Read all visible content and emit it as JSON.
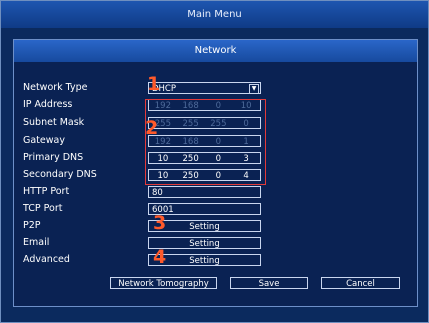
{
  "window": {
    "title": "Main Menu"
  },
  "dialog": {
    "title": "Network"
  },
  "fields": {
    "network_type": {
      "label": "Network Type",
      "value": "DHCP"
    },
    "ip_address": {
      "label": "IP Address",
      "octets": [
        "192",
        "168",
        "0",
        "10"
      ]
    },
    "subnet_mask": {
      "label": "Subnet Mask",
      "octets": [
        "255",
        "255",
        "255",
        "0"
      ]
    },
    "gateway": {
      "label": "Gateway",
      "octets": [
        "192",
        "168",
        "0",
        "1"
      ]
    },
    "primary_dns": {
      "label": "Primary DNS",
      "octets": [
        "10",
        "250",
        "0",
        "3"
      ]
    },
    "secondary_dns": {
      "label": "Secondary DNS",
      "octets": [
        "10",
        "250",
        "0",
        "4"
      ]
    },
    "http_port": {
      "label": "HTTP Port",
      "value": "80"
    },
    "tcp_port": {
      "label": "TCP Port",
      "value": "6001"
    },
    "p2p": {
      "label": "P2P",
      "button": "Setting"
    },
    "email": {
      "label": "Email",
      "button": "Setting"
    },
    "advanced": {
      "label": "Advanced",
      "button": "Setting"
    }
  },
  "annotations": {
    "m1": "1",
    "m2": "2",
    "m3": "3",
    "m4": "4",
    "color": "#ff5a2b"
  },
  "buttons": {
    "network_tomography": "Network Tomography",
    "save": "Save",
    "cancel": "Cancel"
  }
}
